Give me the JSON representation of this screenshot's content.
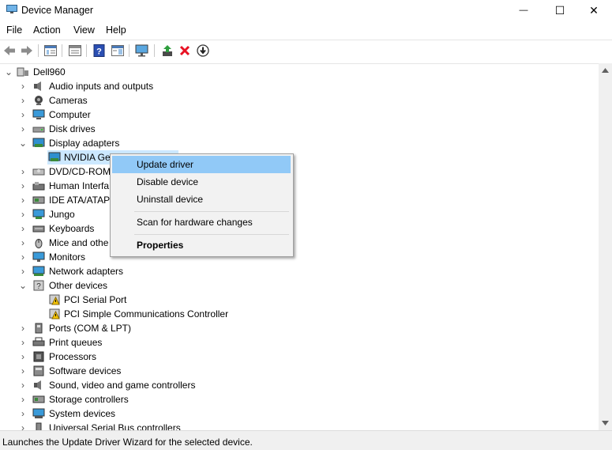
{
  "window": {
    "title": "Device Manager",
    "minimize_glyph": "—",
    "maximize_glyph": "☐",
    "close_glyph": "✕"
  },
  "menu": {
    "items": [
      "File",
      "Action",
      "View",
      "Help"
    ]
  },
  "toolbar": {
    "buttons": [
      "back-arrow-icon",
      "forward-arrow-icon",
      "show-hide-tree-icon",
      "properties-icon",
      "help-icon",
      "action-pane-icon",
      "scan-hardware-icon",
      "update-driver-icon",
      "uninstall-device-icon",
      "disable-device-icon"
    ]
  },
  "tree": {
    "root": "Dell960",
    "items": [
      {
        "label": "Audio inputs and outputs",
        "icon": "speaker-icon"
      },
      {
        "label": "Cameras",
        "icon": "camera-icon"
      },
      {
        "label": "Computer",
        "icon": "computer-icon"
      },
      {
        "label": "Disk drives",
        "icon": "disk-drive-icon"
      },
      {
        "label": "Display adapters",
        "icon": "display-adapter-icon"
      },
      {
        "label": "NVIDIA Ge(",
        "icon": "display-adapter-icon"
      },
      {
        "label": "DVD/CD-ROM",
        "icon": "dvd-icon"
      },
      {
        "label": "Human Interfa",
        "icon": "hid-icon"
      },
      {
        "label": "IDE ATA/ATAPI",
        "icon": "ide-icon"
      },
      {
        "label": "Jungo",
        "icon": "jungo-icon"
      },
      {
        "label": "Keyboards",
        "icon": "keyboard-icon"
      },
      {
        "label": "Mice and othe",
        "icon": "mouse-icon"
      },
      {
        "label": "Monitors",
        "icon": "monitor-icon"
      },
      {
        "label": "Network adapters",
        "icon": "network-icon"
      },
      {
        "label": "Other devices",
        "icon": "other-devices-icon"
      },
      {
        "label": "PCI Serial Port",
        "icon": "warning-device-icon"
      },
      {
        "label": "PCI Simple Communications Controller",
        "icon": "warning-device-icon"
      },
      {
        "label": "Ports (COM & LPT)",
        "icon": "port-icon"
      },
      {
        "label": "Print queues",
        "icon": "printer-icon"
      },
      {
        "label": "Processors",
        "icon": "processor-icon"
      },
      {
        "label": "Software devices",
        "icon": "software-device-icon"
      },
      {
        "label": "Sound, video and game controllers",
        "icon": "sound-icon"
      },
      {
        "label": "Storage controllers",
        "icon": "storage-icon"
      },
      {
        "label": "System devices",
        "icon": "system-device-icon"
      },
      {
        "label": "Universal Serial Bus controllers",
        "icon": "usb-icon"
      }
    ]
  },
  "context_menu": {
    "items": [
      "Update driver",
      "Disable device",
      "Uninstall device",
      "Scan for hardware changes",
      "Properties"
    ]
  },
  "status": {
    "text": "Launches the Update Driver Wizard for the selected device."
  },
  "colors": {
    "menu_highlight": "#91c9f7",
    "selection": "#cce8ff",
    "uninstall_x": "#e81123",
    "update_arrow": "#2e9e3e"
  }
}
